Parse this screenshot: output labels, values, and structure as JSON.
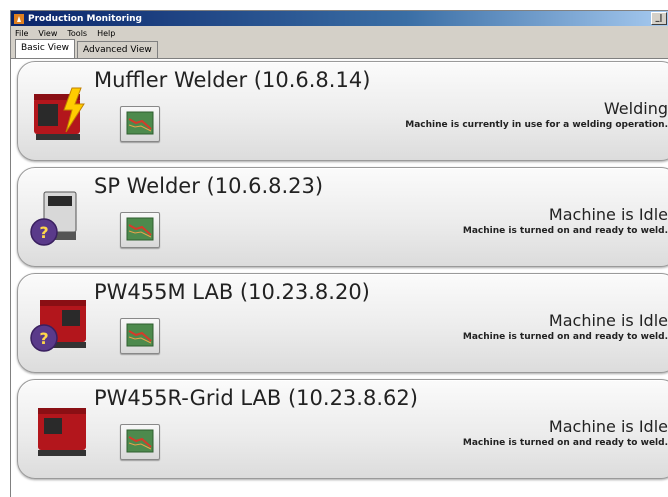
{
  "window": {
    "title": "Production Monitoring",
    "control_glyph": "_|"
  },
  "menu": [
    "File",
    "View",
    "Tools",
    "Help"
  ],
  "tabs": [
    {
      "label": "Basic View",
      "active": true
    },
    {
      "label": "Advanced View",
      "active": false
    }
  ],
  "machines": [
    {
      "name": "Muffler Welder (10.6.8.14)",
      "icon": "welder-active-icon",
      "status": "Welding",
      "description": "Machine is currently in use for a welding operation."
    },
    {
      "name": "SP Welder (10.6.8.23)",
      "icon": "welder-idle-icon",
      "status": "Machine is Idle",
      "description": "Machine is turned on and ready to weld."
    },
    {
      "name": "PW455M LAB (10.23.8.20)",
      "icon": "welder-idle-icon",
      "status": "Machine is Idle",
      "description": "Machine is turned on and ready to weld."
    },
    {
      "name": "PW455R-Grid LAB (10.23.8.62)",
      "icon": "welder-idle-icon",
      "status": "Machine is Idle",
      "description": "Machine is turned on and ready to weld."
    }
  ],
  "colors": {
    "accent": "#0a246a",
    "machine_red": "#b3161c",
    "idle_badge": "#5a3a8a",
    "welding_bolt": "#ffcc00"
  }
}
